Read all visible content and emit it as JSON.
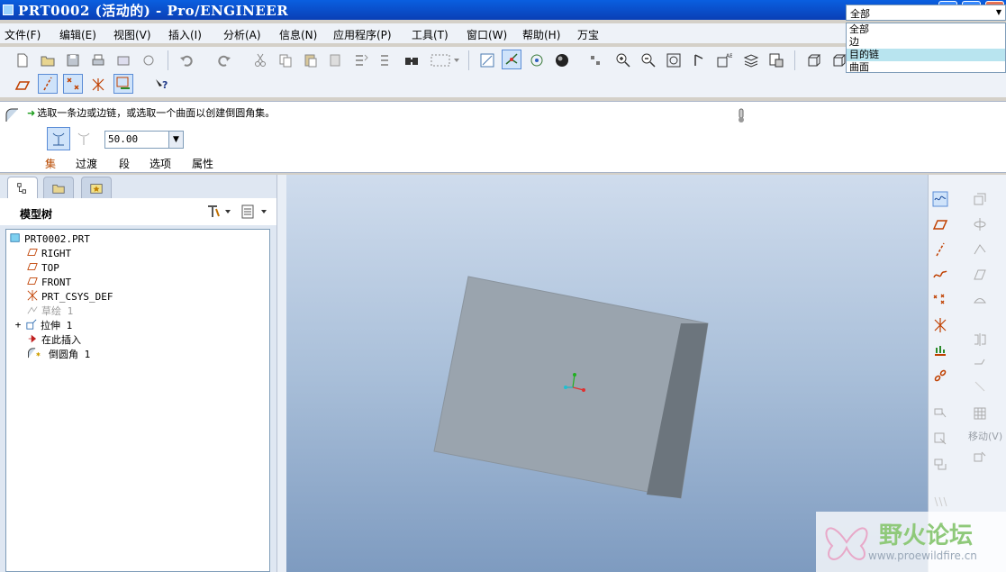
{
  "window": {
    "title": "PRT0002 (活动的) - Pro/ENGINEER"
  },
  "menu": [
    {
      "label": "文件(F)"
    },
    {
      "label": "编辑(E)"
    },
    {
      "label": "视图(V)"
    },
    {
      "label": "插入(I)"
    },
    {
      "label": "分析(A)"
    },
    {
      "label": "信息(N)"
    },
    {
      "label": "应用程序(P)"
    },
    {
      "label": "工具(T)"
    },
    {
      "label": "窗口(W)"
    },
    {
      "label": "帮助(H)"
    },
    {
      "label": "万宝"
    }
  ],
  "dashboard": {
    "prompt": "选取一条边或边链，或选取一个曲面以创建倒圆角集。",
    "radius_value": "50.00",
    "tabs": [
      "集",
      "过渡",
      "段",
      "选项",
      "属性"
    ],
    "filter": {
      "selected": "全部",
      "options": [
        "全部",
        "边",
        "目的链",
        "曲面"
      ],
      "highlighted": "目的链"
    }
  },
  "model_tree": {
    "title": "模型树",
    "items": [
      {
        "label": "PRT0002.PRT",
        "icon": "part-icon"
      },
      {
        "label": "RIGHT",
        "icon": "datum-plane-icon"
      },
      {
        "label": "TOP",
        "icon": "datum-plane-icon"
      },
      {
        "label": "FRONT",
        "icon": "datum-plane-icon"
      },
      {
        "label": "PRT_CSYS_DEF",
        "icon": "csys-icon"
      },
      {
        "label": "草绘 1",
        "icon": "sketch-icon"
      },
      {
        "label": "拉伸 1",
        "icon": "extrude-icon"
      },
      {
        "label": "在此插入",
        "icon": "insert-here-icon"
      },
      {
        "label": "倒圆角 1",
        "icon": "round-icon"
      }
    ]
  },
  "right_toolbar": {
    "move_label": "移动(V)"
  },
  "watermark": {
    "text": "野火论坛",
    "url": "www.proewildfire.cn"
  },
  "colors": {
    "titlebar": "#0a4fd0",
    "accent_select": "#b8e4ef",
    "part_face": "#9aa4ae",
    "part_side": "#6c757d"
  }
}
